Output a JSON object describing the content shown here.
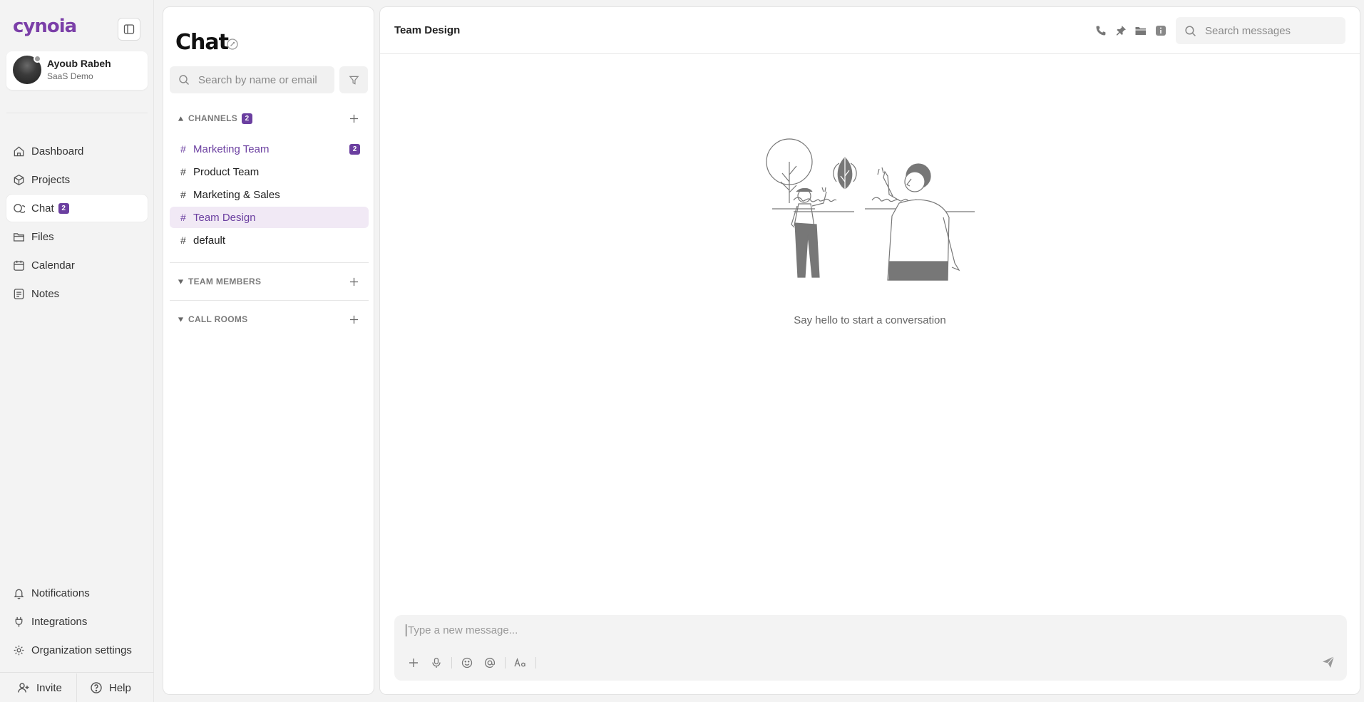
{
  "app": {
    "logo_text": "cynoia"
  },
  "user": {
    "name": "Ayoub Rabeh",
    "org": "SaaS Demo"
  },
  "nav": {
    "items": [
      {
        "label": "Dashboard",
        "icon": "home-icon"
      },
      {
        "label": "Projects",
        "icon": "cube-icon"
      },
      {
        "label": "Chat",
        "icon": "chat-icon",
        "badge": "2",
        "active": true
      },
      {
        "label": "Files",
        "icon": "folder-icon"
      },
      {
        "label": "Calendar",
        "icon": "calendar-icon"
      },
      {
        "label": "Notes",
        "icon": "note-icon"
      }
    ],
    "bottom_items": [
      {
        "label": "Notifications",
        "icon": "bell-icon"
      },
      {
        "label": "Integrations",
        "icon": "plug-icon"
      },
      {
        "label": "Organization settings",
        "icon": "gear-icon"
      }
    ],
    "invite_label": "Invite",
    "help_label": "Help"
  },
  "panel": {
    "title": "Chat",
    "search_placeholder": "Search by name or email",
    "channels_header": "CHANNELS",
    "channels_count": "2",
    "channels": [
      {
        "name": "Marketing Team",
        "badge": "2",
        "unread": true
      },
      {
        "name": "Product Team"
      },
      {
        "name": "Marketing & Sales"
      },
      {
        "name": "Team Design",
        "selected": true
      },
      {
        "name": "default"
      }
    ],
    "team_members_header": "TEAM MEMBERS",
    "call_rooms_header": "CALL ROOMS"
  },
  "conversation": {
    "title": "Team Design",
    "search_placeholder": "Search messages",
    "empty_text": "Say hello to start a conversation",
    "composer_placeholder": "Type a new message...",
    "header_icons": [
      "phone-icon",
      "pin-icon",
      "folder-icon",
      "info-icon"
    ]
  },
  "colors": {
    "accent": "#6b3fa0",
    "selected_bg": "#f1e9f5"
  }
}
